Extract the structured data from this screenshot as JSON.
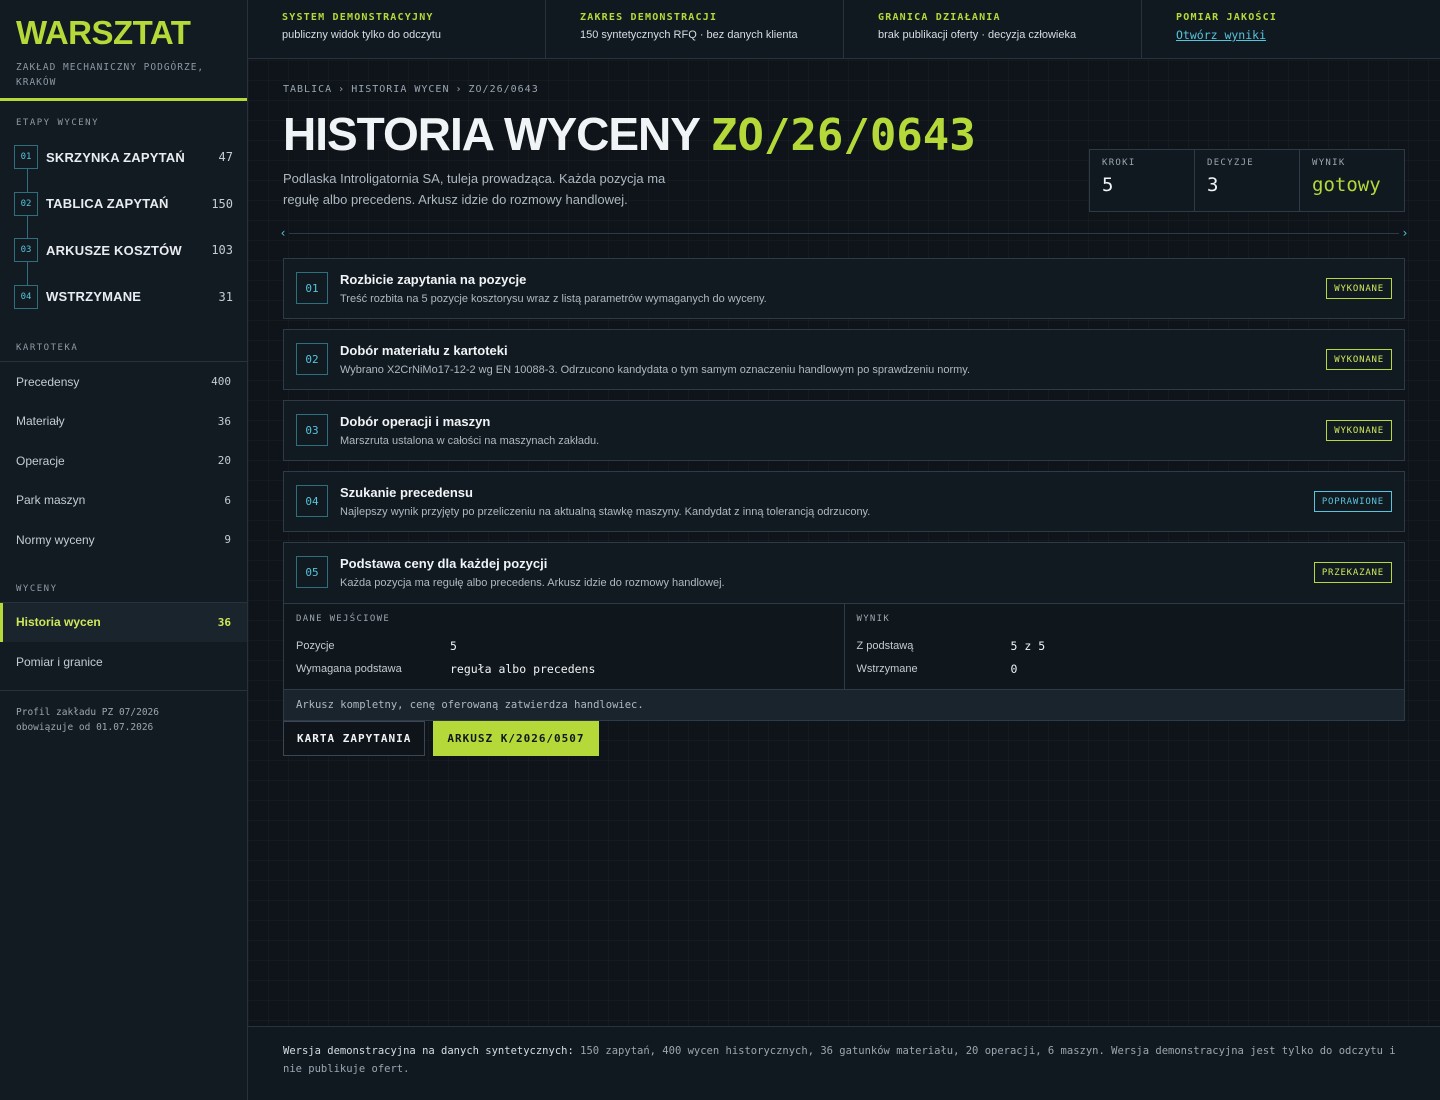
{
  "brand": {
    "title": "WARSZTAT",
    "subtitle": "ZAKŁAD MECHANICZNY PODGÓRZE, KRAKÓW"
  },
  "sidebar": {
    "stages_label": "ETAPY WYCENY",
    "stages": [
      {
        "num": "01",
        "label": "SKRZYNKA ZAPYTAŃ",
        "count": "47"
      },
      {
        "num": "02",
        "label": "TABLICA ZAPYTAŃ",
        "count": "150"
      },
      {
        "num": "03",
        "label": "ARKUSZE KOSZTÓW",
        "count": "103"
      },
      {
        "num": "04",
        "label": "WSTRZYMANE",
        "count": "31"
      }
    ],
    "kartoteka_label": "KARTOTEKA",
    "kartoteka": [
      {
        "label": "Precedensy",
        "count": "400"
      },
      {
        "label": "Materiały",
        "count": "36"
      },
      {
        "label": "Operacje",
        "count": "20"
      },
      {
        "label": "Park maszyn",
        "count": "6"
      },
      {
        "label": "Normy wyceny",
        "count": "9"
      }
    ],
    "wyceny_label": "WYCENY",
    "wyceny": [
      {
        "label": "Historia wycen",
        "count": "36"
      },
      {
        "label": "Pomiar i granice",
        "count": ""
      }
    ],
    "profile_line1": "Profil zakładu PZ 07/2026",
    "profile_line2": "obowiązuje od 01.07.2026"
  },
  "topbar": [
    {
      "title": "SYSTEM DEMONSTRACYJNY",
      "value": "publiczny widok tylko do odczytu"
    },
    {
      "title": "ZAKRES DEMONSTRACJI",
      "value": "150 syntetycznych RFQ · bez danych klienta"
    },
    {
      "title": "GRANICA DZIAŁANIA",
      "value": "brak publikacji oferty · decyzja człowieka"
    },
    {
      "title": "POMIAR JAKOŚCI",
      "value": "Otwórz wyniki"
    }
  ],
  "breadcrumb": {
    "a": "TABLICA",
    "b": "HISTORIA WYCEN",
    "c": "ZO/26/0643",
    "sep": "›"
  },
  "page": {
    "title": "HISTORIA WYCENY",
    "code": "ZO/26/0643",
    "lead": "Podlaska Introligatornia SA, tuleja prowadząca. Każda pozycja ma regułę albo precedens. Arkusz idzie do rozmowy handlowej."
  },
  "kpis": [
    {
      "label": "KROKI",
      "value": "5"
    },
    {
      "label": "DECYZJE",
      "value": "3"
    },
    {
      "label": "WYNIK",
      "value": "gotowy"
    }
  ],
  "steps": [
    {
      "num": "01",
      "title": "Rozbicie zapytania na pozycje",
      "desc": "Treść rozbita na 5 pozycje kosztorysu wraz z listą parametrów wymaganych do wyceny.",
      "status": "WYKONANE"
    },
    {
      "num": "02",
      "title": "Dobór materiału z kartoteki",
      "desc": "Wybrano X2CrNiMo17-12-2 wg EN 10088-3. Odrzucono kandydata o tym samym oznaczeniu handlowym po sprawdzeniu normy.",
      "status": "WYKONANE"
    },
    {
      "num": "03",
      "title": "Dobór operacji i maszyn",
      "desc": "Marszruta ustalona w całości na maszynach zakładu.",
      "status": "WYKONANE"
    },
    {
      "num": "04",
      "title": "Szukanie precedensu",
      "desc": "Najlepszy wynik przyjęty po przeliczeniu na aktualną stawkę maszyny. Kandydat z inną tolerancją odrzucony.",
      "status": "POPRAWIONE"
    },
    {
      "num": "05",
      "title": "Podstawa ceny dla każdej pozycji",
      "desc": "Każda pozycja ma regułę albo precedens. Arkusz idzie do rozmowy handlowej.",
      "status": "PRZEKAZANE"
    }
  ],
  "detail": {
    "inputs_label": "DANE WEJŚCIOWE",
    "inputs": [
      {
        "k": "Pozycje",
        "v": "5"
      },
      {
        "k": "Wymagana podstawa",
        "v": "reguła albo precedens"
      }
    ],
    "result_label": "WYNIK",
    "results": [
      {
        "k": "Z podstawą",
        "v": "5 z 5"
      },
      {
        "k": "Wstrzymane",
        "v": "0"
      }
    ],
    "note": "Arkusz kompletny, cenę oferowaną zatwierdza handlowiec."
  },
  "actions": {
    "card": "KARTA ZAPYTANIA",
    "sheet": "ARKUSZ K/2026/0507"
  },
  "footer": {
    "lead": "Wersja demonstracyjna na danych syntetycznych:",
    "text": " 150 zapytań, 400 wycen historycznych, 36 gatunków materiału, 20 operacji, 6 maszyn. Wersja demonstracyjna jest tylko do odczytu i nie publikuje ofert."
  },
  "colors": {
    "accent": "#b6d93a",
    "info": "#56c4dc",
    "background": "#0f151b"
  },
  "icons": {
    "scroll_left": "chevron-left-icon",
    "scroll_right": "chevron-right-icon"
  }
}
